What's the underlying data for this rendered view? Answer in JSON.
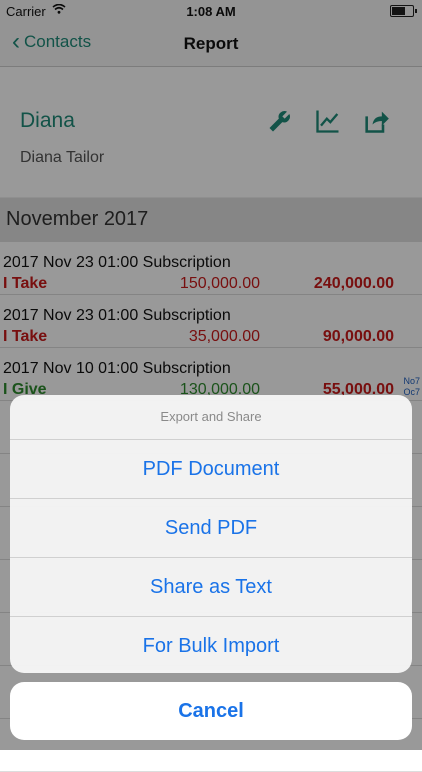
{
  "status_bar": {
    "carrier": "Carrier",
    "time": "1:08 AM"
  },
  "navbar": {
    "back_label": "Contacts",
    "title": "Report"
  },
  "contact": {
    "short_name": "Diana",
    "full_name": "Diana Tailor",
    "actions": [
      "wrench-icon",
      "chart-icon",
      "share-icon"
    ]
  },
  "month": "November 2017",
  "transactions": [
    {
      "datetime": "2017 Nov 23  01:00",
      "type": "Subscription",
      "kind": "I Take",
      "amount": "150,000.00",
      "balance": "240,000.00",
      "color": "#c81a1a",
      "balance_color": "#c81a1a"
    },
    {
      "datetime": "2017 Nov 23  01:00",
      "type": "Subscription",
      "kind": "I Take",
      "amount": "35,000.00",
      "balance": "90,000.00",
      "color": "#c81a1a",
      "balance_color": "#c81a1a"
    },
    {
      "datetime": "2017 Nov 10  01:00",
      "type": "Subscription",
      "kind": "I Give",
      "amount": "130,000.00",
      "balance": "55,000.00",
      "color": "#2e8a2e",
      "balance_color": "#c81a1a",
      "side_notes": [
        "No7",
        "Oc7"
      ]
    }
  ],
  "action_sheet": {
    "title": "Export and Share",
    "options": [
      "PDF Document",
      "Send PDF",
      "Share as Text",
      "For Bulk Import"
    ],
    "cancel": "Cancel"
  }
}
